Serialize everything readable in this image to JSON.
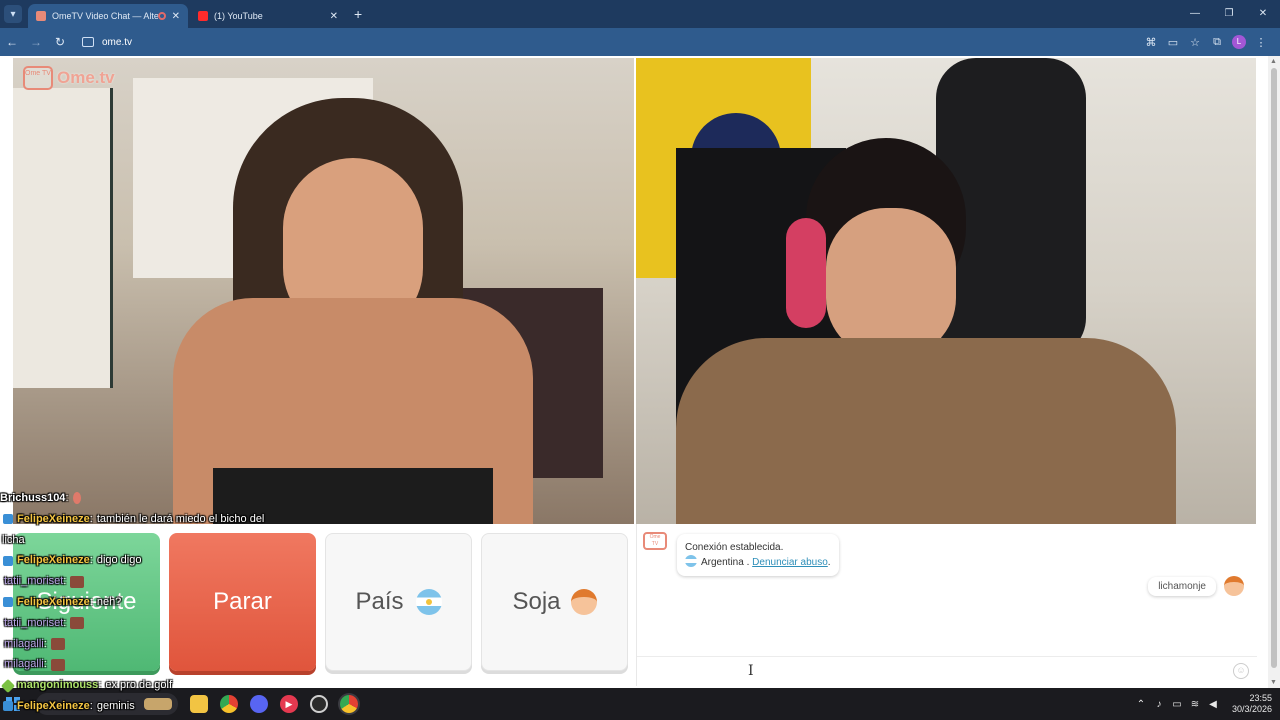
{
  "browser": {
    "tabs": [
      {
        "title": "OmeTV Video Chat — Alte",
        "active": true
      },
      {
        "title": "(1) YouTube",
        "active": false
      }
    ],
    "url": "ome.tv",
    "profile_initial": "L"
  },
  "brand": {
    "logo_text": "Ome.tv",
    "logo_badge": "Ome TV"
  },
  "controls": {
    "next_label": "Siguiente",
    "stop_label": "Parar",
    "country_label": "País",
    "gender_label": "Soja"
  },
  "chat": {
    "system": {
      "line1": "Conexión establecida.",
      "country": "Argentina",
      "sep": " . ",
      "report_link": "Denunciar abuso",
      "end": "."
    },
    "my_message": "lichamonje",
    "input_placeholder": ""
  },
  "overlay": [
    {
      "user": "Brichuss104",
      "sep": " :",
      "msg": "",
      "style": "white"
    },
    {
      "user": "FelipeXeineze",
      "sep": " :",
      "msg": "también le dará miedo el bicho del",
      "style": "gold"
    },
    {
      "user": "",
      "sep": "",
      "msg": "licha",
      "style": "wrap"
    },
    {
      "user": "FelipeXeineze",
      "sep": " :",
      "msg": "digo digo",
      "style": "gold"
    },
    {
      "user": "tatii_moriset",
      "sep": " :",
      "msg": "",
      "style": "purple"
    },
    {
      "user": "FelipeXeineze",
      "sep": " :",
      "msg": "neh?",
      "style": "gold"
    },
    {
      "user": "tatii_moriset",
      "sep": " :",
      "msg": "",
      "style": "purple"
    },
    {
      "user": "milagalli",
      "sep": " :",
      "msg": "",
      "style": "purple"
    },
    {
      "user": "milagalli",
      "sep": " :",
      "msg": "",
      "style": "purple"
    },
    {
      "user": "mangonimouss",
      "sep": " :",
      "msg": "ex pro de golf",
      "style": "green"
    },
    {
      "user": "FelipeXeineze",
      "sep": " :",
      "msg": "geminis",
      "style": "gold"
    }
  ],
  "taskbar": {
    "time": "23:55",
    "date": "30/3/2026"
  },
  "colors": {
    "next": "#4fb874",
    "stop": "#e0553c",
    "brand": "#e88a78",
    "link": "#2f8fb9"
  }
}
